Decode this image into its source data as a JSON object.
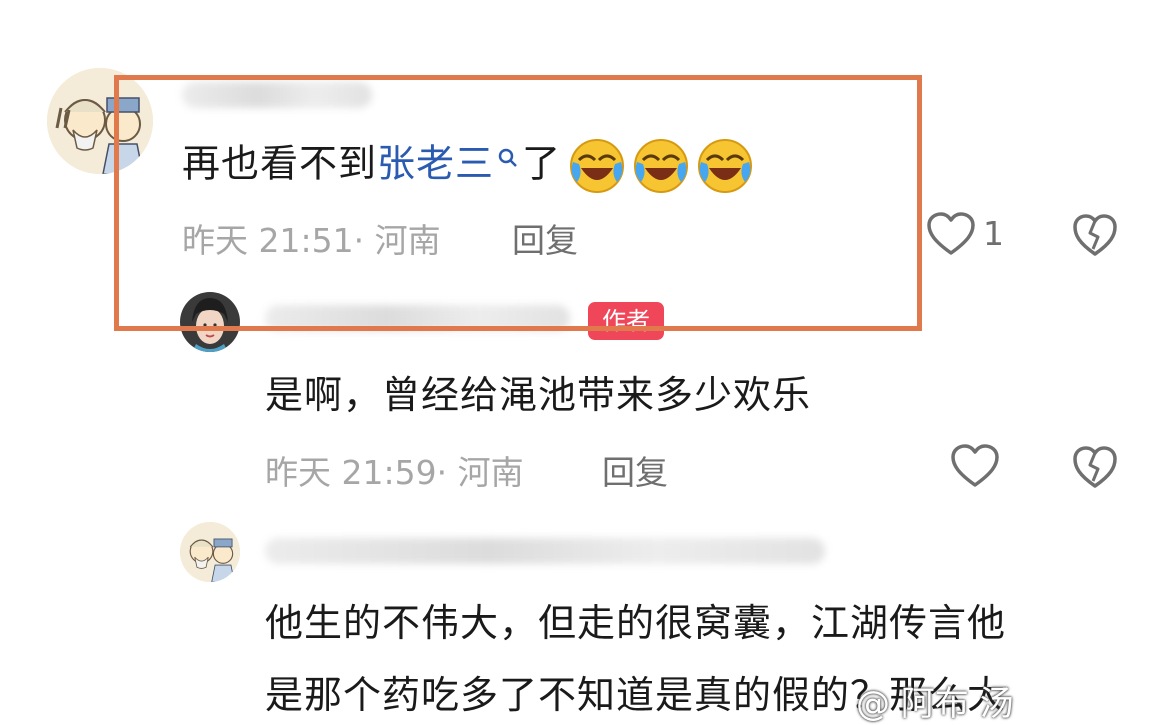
{
  "comment": {
    "text_prefix": "再也看不到",
    "mention": "张老三",
    "text_suffix": "了",
    "emojis": [
      "laughing-crying-emoji",
      "laughing-crying-emoji",
      "laughing-crying-emoji"
    ],
    "time": "昨天 21:51· 河南",
    "reply_label": "回复",
    "like_count": "1"
  },
  "reply1": {
    "badge": "作者",
    "text": "是啊，曾经给渑池带来多少欢乐",
    "time": "昨天 21:59· 河南",
    "reply_label": "回复"
  },
  "reply2": {
    "line1": "他生的不伟大，但走的很窝囊，江湖传言他",
    "line2": "是那个药吃多了不知道是真的假的？那么大"
  },
  "watermark": "@ 阿布 汤",
  "colors": {
    "highlight": "#e07a4c",
    "mention": "#2a5bb0",
    "badge": "#f0465a",
    "meta": "#a6a6a6"
  },
  "icons": [
    "heart-icon",
    "broken-heart-icon",
    "search-icon"
  ]
}
